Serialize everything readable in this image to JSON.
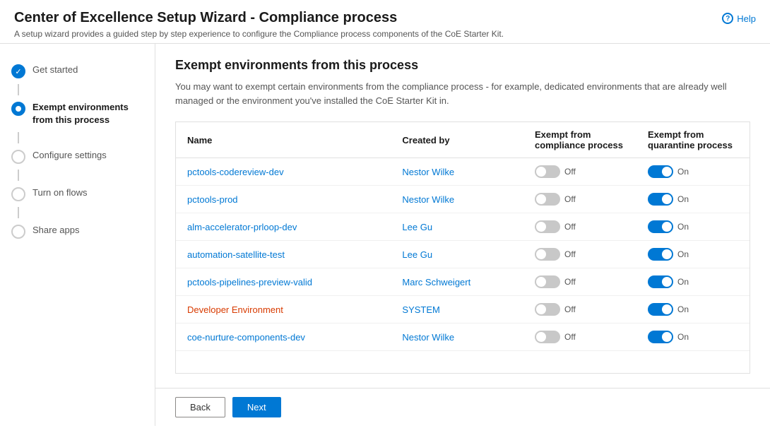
{
  "header": {
    "title": "Center of Excellence Setup Wizard - Compliance process",
    "subtitle": "A setup wizard provides a guided step by step experience to configure the Compliance process components of the CoE Starter Kit.",
    "help_label": "Help"
  },
  "sidebar": {
    "items": [
      {
        "id": "get-started",
        "label": "Get started",
        "state": "completed"
      },
      {
        "id": "exempt-environments",
        "label": "Exempt environments from this process",
        "state": "active"
      },
      {
        "id": "configure-settings",
        "label": "Configure settings",
        "state": "inactive"
      },
      {
        "id": "turn-on-flows",
        "label": "Turn on flows",
        "state": "inactive"
      },
      {
        "id": "share-apps",
        "label": "Share apps",
        "state": "inactive"
      }
    ]
  },
  "section": {
    "title": "Exempt environments from this process",
    "description": "You may want to exempt certain environments from the compliance process - for example, dedicated environments that are already well managed or the environment you've installed the CoE Starter Kit in."
  },
  "table": {
    "columns": [
      {
        "id": "name",
        "label": "Name"
      },
      {
        "id": "created_by",
        "label": "Created by"
      },
      {
        "id": "exempt_compliance",
        "label": "Exempt from compliance process"
      },
      {
        "id": "exempt_quarantine",
        "label": "Exempt from quarantine process"
      }
    ],
    "rows": [
      {
        "name": "pctools-codereview-dev",
        "created_by": "Nestor Wilke",
        "compliance": false,
        "quarantine": true,
        "name_style": "link"
      },
      {
        "name": "pctools-prod",
        "created_by": "Nestor Wilke",
        "compliance": false,
        "quarantine": true,
        "name_style": "link"
      },
      {
        "name": "alm-accelerator-prloop-dev",
        "created_by": "Lee Gu",
        "compliance": false,
        "quarantine": true,
        "name_style": "link"
      },
      {
        "name": "automation-satellite-test",
        "created_by": "Lee Gu",
        "compliance": false,
        "quarantine": true,
        "name_style": "link"
      },
      {
        "name": "pctools-pipelines-preview-valid",
        "created_by": "Marc Schweigert",
        "compliance": false,
        "quarantine": true,
        "name_style": "link"
      },
      {
        "name": "Developer Environment",
        "created_by": "SYSTEM",
        "compliance": false,
        "quarantine": true,
        "name_style": "orange"
      },
      {
        "name": "coe-nurture-components-dev",
        "created_by": "Nestor Wilke",
        "compliance": false,
        "quarantine": true,
        "name_style": "link"
      }
    ],
    "toggle_off_label": "Off",
    "toggle_on_label": "On"
  },
  "footer": {
    "back_label": "Back",
    "next_label": "Next"
  }
}
